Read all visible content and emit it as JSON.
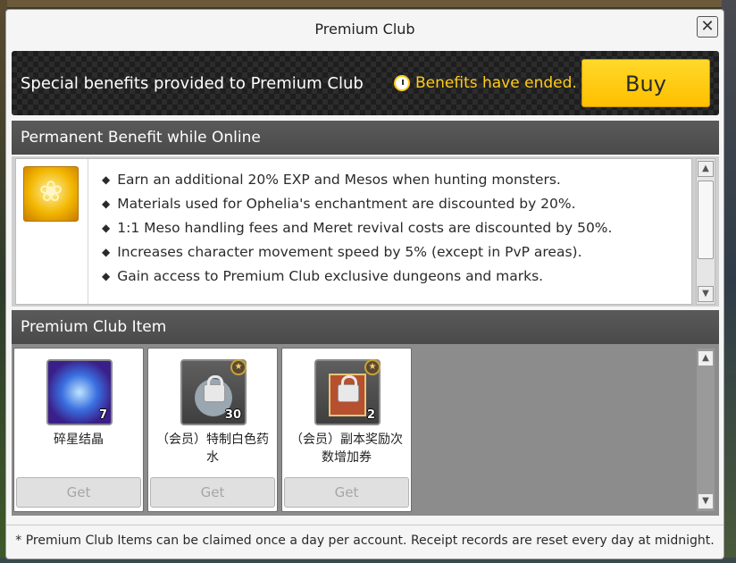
{
  "window": {
    "title": "Premium Club",
    "close_label": "✕"
  },
  "banner": {
    "text": "Special benefits provided to Premium Club",
    "status": "Benefits have ended.",
    "buy_label": "Buy"
  },
  "permanent": {
    "header": "Permanent Benefit while Online",
    "benefits": [
      "Earn an additional 20% EXP and Mesos when hunting monsters.",
      "Materials used for Ophelia's enchantment are discounted by 20%.",
      "1:1 Meso handling fees and Meret revival costs are discounted by 50%.",
      "Increases character movement speed by 5% (except in PvP areas).",
      "Gain access to Premium Club exclusive dungeons and marks."
    ],
    "icon": "golden-leaf-icon"
  },
  "items": {
    "header": "Premium Club Item",
    "list": [
      {
        "name": "碎星结晶",
        "count": "7",
        "icon": "crystal-cube-icon",
        "get_label": "Get"
      },
      {
        "name": "（会员）特制白色药水",
        "count": "30",
        "icon": "white-potion-icon",
        "get_label": "Get"
      },
      {
        "name": "（会员）副本奖励次数增加券",
        "count": "2",
        "icon": "dungeon-ticket-icon",
        "get_label": "Get"
      }
    ]
  },
  "footnote": "* Premium Club Items can be claimed once a day per account. Receipt records are reset every day at midnight.",
  "colors": {
    "accent": "#ffcc1a",
    "buy_button": "#ffd200",
    "header_bg": "#525252"
  }
}
